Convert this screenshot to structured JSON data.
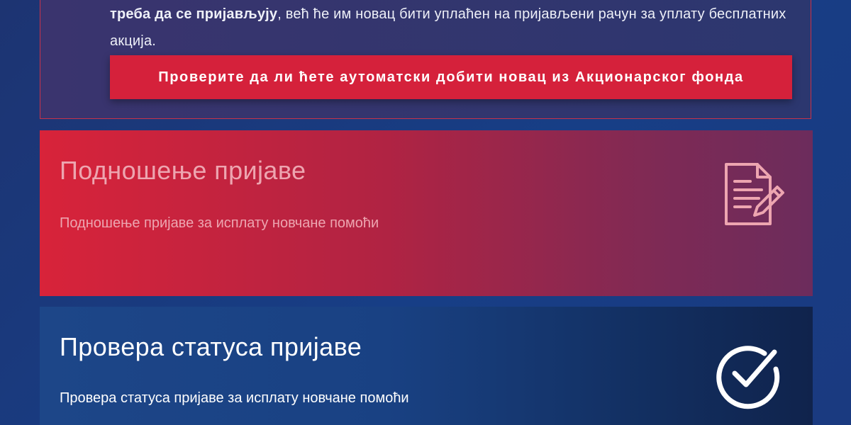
{
  "info": {
    "text_bold": "треба да се пријављују",
    "text_rest": ", већ ће им новац бити уплаћен на пријављени рачун за уплату бесплатних акција.",
    "button_label": "Проверите да ли ћете аутоматски добити новац из Акционарског фонда"
  },
  "cards": {
    "submit": {
      "title": "Подношење пријаве",
      "description": "Подношење пријаве за исплату новчане помоћи",
      "icon": "document-edit-icon"
    },
    "status": {
      "title": "Провера статуса пријаве",
      "description": "Провера статуса пријаве за исплату новчане помоћи",
      "icon": "check-circle-icon"
    }
  },
  "colors": {
    "accent_red": "#d5213b",
    "navy": "#173e86"
  }
}
